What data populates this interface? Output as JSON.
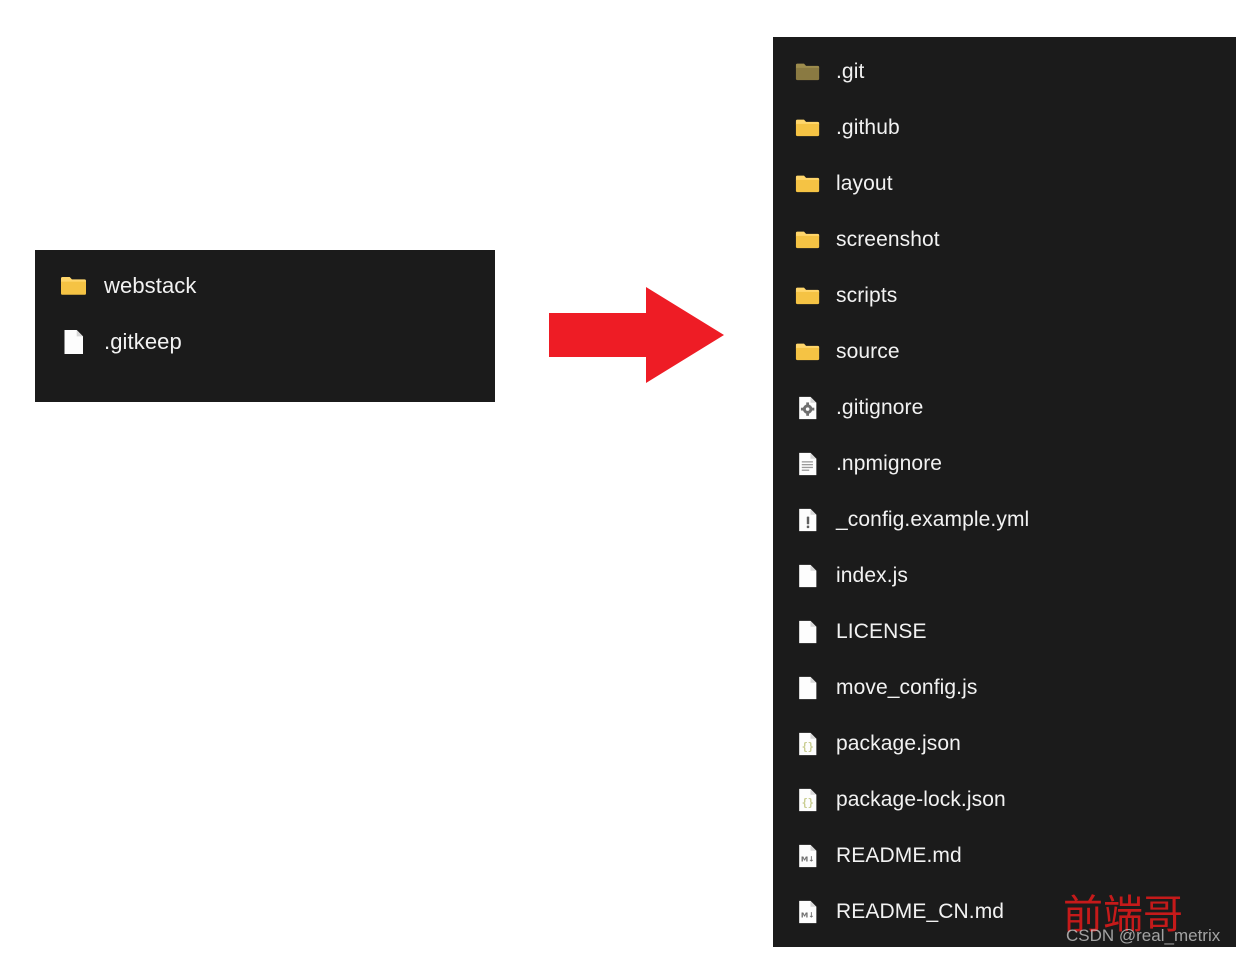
{
  "colors": {
    "panel_background": "#1b1b1b",
    "page_background": "#ffffff",
    "text": "#f2f2f2",
    "folder": "#f5c344",
    "folder_dim": "#8a7a42",
    "arrow_red": "#ee1c25",
    "watermark_red": "#d41a1a",
    "json_glyph": "#c8cc8f",
    "file_white": "#fdfdfd"
  },
  "left_panel": {
    "name": "source-folder-listing",
    "items": [
      {
        "label": "webstack",
        "icon": "folder-icon",
        "type": "folder",
        "dim": false
      },
      {
        "label": ".gitkeep",
        "icon": "file-blank-icon",
        "type": "file",
        "dim": false
      }
    ]
  },
  "right_panel": {
    "name": "destination-folder-listing",
    "items": [
      {
        "label": ".git",
        "icon": "folder-icon",
        "type": "folder",
        "dim": true
      },
      {
        "label": ".github",
        "icon": "folder-icon",
        "type": "folder",
        "dim": false
      },
      {
        "label": "layout",
        "icon": "folder-icon",
        "type": "folder",
        "dim": false
      },
      {
        "label": "screenshot",
        "icon": "folder-icon",
        "type": "folder",
        "dim": false
      },
      {
        "label": "scripts",
        "icon": "folder-icon",
        "type": "folder",
        "dim": false
      },
      {
        "label": "source",
        "icon": "folder-icon",
        "type": "folder",
        "dim": false
      },
      {
        "label": ".gitignore",
        "icon": "file-gear-icon",
        "type": "file",
        "dim": false
      },
      {
        "label": ".npmignore",
        "icon": "file-lines-icon",
        "type": "file",
        "dim": false
      },
      {
        "label": "_config.example.yml",
        "icon": "file-warning-icon",
        "type": "file",
        "dim": false
      },
      {
        "label": "index.js",
        "icon": "file-blank-icon",
        "type": "file",
        "dim": false
      },
      {
        "label": "LICENSE",
        "icon": "file-blank-icon",
        "type": "file",
        "dim": false
      },
      {
        "label": "move_config.js",
        "icon": "file-blank-icon",
        "type": "file",
        "dim": false
      },
      {
        "label": "package.json",
        "icon": "file-json-icon",
        "type": "file",
        "dim": false
      },
      {
        "label": "package-lock.json",
        "icon": "file-json-icon",
        "type": "file",
        "dim": false
      },
      {
        "label": "README.md",
        "icon": "file-markdown-icon",
        "type": "file",
        "dim": false
      },
      {
        "label": "README_CN.md",
        "icon": "file-markdown-icon",
        "type": "file",
        "dim": false
      }
    ]
  },
  "arrow": {
    "name": "right-arrow-annotation",
    "direction": "right",
    "color": "#ee1c25"
  },
  "watermark": {
    "chinese_text": "前端哥",
    "csdn_text": "CSDN @real_metrix"
  }
}
